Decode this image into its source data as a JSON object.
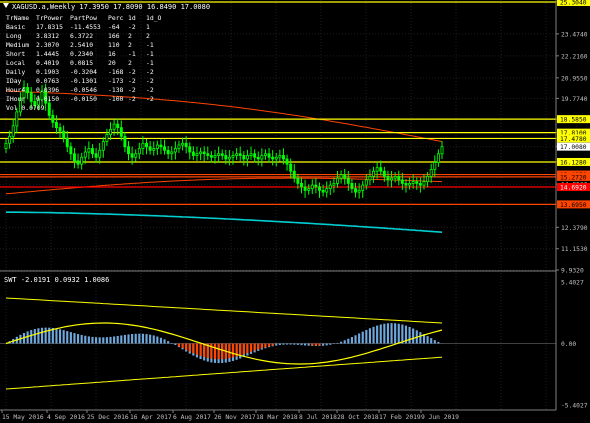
{
  "header": {
    "title": "XAGUSD.a,Weekly  17.3950 17.8090 16.8490 17.0080"
  },
  "info_table": {
    "header": [
      "TrName",
      "TrPower",
      "PartPow",
      "Perc",
      "1d",
      "1d_O"
    ],
    "rows": [
      [
        "Basic",
        "17.8315",
        "-11.4553",
        "-64",
        "-2",
        "1"
      ],
      [
        "Long",
        "3.8312",
        "6.3722",
        "166",
        "2",
        "2"
      ],
      [
        "Medium",
        "2.3070",
        "2.5410",
        "110",
        "2",
        "-1"
      ],
      [
        "Short",
        "1.4445",
        "0.2340",
        "16",
        "-1",
        "-1"
      ],
      [
        "Local",
        "0.4019",
        "0.0815",
        "20",
        "2",
        "-1"
      ],
      [
        "Daily",
        "0.1903",
        "-0.3204",
        "-168",
        "-2",
        "-2"
      ],
      [
        "IDay",
        "0.0763",
        "-0.1301",
        "-173",
        "-2",
        "-2"
      ],
      [
        "Hour4",
        "0.0396",
        "-0.0546",
        "-138",
        "-2",
        "-2"
      ],
      [
        "IHour",
        "0.0150",
        "-0.0150",
        "-100",
        "-2",
        "-2"
      ]
    ],
    "extra": "Vol 0.0709"
  },
  "sub_header": "SWT -2.0191 0.0932 1.0086",
  "price_axis": [
    "25.3040",
    "23.4740",
    "22.2160",
    "20.9550",
    "19.7740",
    "18.5850",
    "17.8100",
    "17.4780",
    "17.0080",
    "16.1280",
    "14.8530",
    "12.3790",
    "11.1530",
    "9.9320"
  ],
  "level_labels": [
    {
      "text": "25.3040",
      "bg": "#ffff00",
      "fg": "#000000"
    },
    {
      "text": "18.5850",
      "bg": "#ffff00",
      "fg": "#000000"
    },
    {
      "text": "17.8100",
      "bg": "#ffff00",
      "fg": "#000000"
    },
    {
      "text": "17.4780",
      "bg": "#ffff00",
      "fg": "#000000"
    },
    {
      "text": "17.0080",
      "bg": "#ffffff",
      "fg": "#000000"
    },
    {
      "text": "16.1280",
      "bg": "#ffff00",
      "fg": "#000000"
    },
    {
      "text": "15.4070",
      "bg": "#ff4500",
      "fg": "#000000"
    },
    {
      "text": "15.2720",
      "bg": "#ff4500",
      "fg": "#000000"
    },
    {
      "text": "14.6920",
      "bg": "#ff0000",
      "fg": "#ffffff"
    },
    {
      "text": "13.6950",
      "bg": "#ff4500",
      "fg": "#000000"
    }
  ],
  "osc_axis": [
    "5.4027",
    "0.00",
    "-5.4027"
  ],
  "time_axis": [
    "15 May 2016",
    "4 Sep 2016",
    "25 Dec 2016",
    "16 Apr 2017",
    "6 Aug 2017",
    "26 Nov 2017",
    "18 Mar 2018",
    "8 Jul 2018",
    "28 Oct 2018",
    "17 Feb 2019",
    "9 Jun 2019"
  ],
  "chart_data": {
    "type": "candlestick",
    "symbol": "XAGUSD.a",
    "timeframe": "Weekly",
    "last": {
      "open": 17.395,
      "high": 17.809,
      "low": 16.849,
      "close": 17.008
    },
    "price_range": [
      9.932,
      25.304
    ],
    "closes": [
      17.2,
      17.6,
      18.2,
      19.0,
      19.8,
      20.4,
      20.1,
      19.6,
      19.4,
      19.7,
      20.2,
      19.5,
      18.8,
      18.4,
      18.1,
      17.9,
      17.5,
      17.0,
      16.6,
      16.2,
      16.0,
      16.4,
      16.7,
      16.9,
      16.6,
      16.4,
      16.8,
      17.3,
      17.7,
      18.0,
      18.3,
      18.1,
      17.6,
      17.0,
      16.6,
      16.4,
      16.6,
      16.9,
      17.2,
      17.0,
      16.8,
      16.9,
      17.1,
      17.0,
      16.8,
      16.6,
      16.7,
      16.9,
      17.1,
      17.2,
      17.0,
      16.7,
      16.5,
      16.6,
      16.7,
      16.6,
      16.5,
      16.4,
      16.5,
      16.6,
      16.5,
      16.3,
      16.4,
      16.5,
      16.6,
      16.5,
      16.3,
      16.5,
      16.6,
      16.4,
      16.3,
      16.5,
      16.6,
      16.4,
      16.3,
      16.4,
      16.5,
      16.3,
      16.0,
      15.6,
      15.2,
      14.9,
      14.7,
      14.5,
      14.6,
      14.8,
      14.7,
      14.5,
      14.4,
      14.6,
      14.8,
      14.9,
      15.2,
      15.4,
      15.2,
      14.9,
      14.6,
      14.4,
      14.5,
      14.8,
      15.1,
      15.3,
      15.6,
      15.8,
      15.6,
      15.3,
      15.1,
      15.2,
      15.3,
      15.1,
      14.9,
      14.8,
      14.9,
      15.0,
      14.9,
      14.8,
      15.0,
      15.3,
      15.7,
      16.1,
      16.6,
      17.0
    ],
    "moving_averages": [
      {
        "color": "#ff4500",
        "start": 20.2,
        "end": 17.3
      },
      {
        "color": "#ff4500",
        "start": 14.3,
        "end": 15.0
      },
      {
        "color": "#00ced1",
        "start": 13.25,
        "end": 12.1
      }
    ],
    "horizontal_levels": [
      {
        "value": 25.304,
        "color": "#ffff00"
      },
      {
        "value": 18.585,
        "color": "#ffff00"
      },
      {
        "value": 17.81,
        "color": "#ffff00"
      },
      {
        "value": 17.478,
        "color": "#ffff00"
      },
      {
        "value": 16.128,
        "color": "#ffff00"
      },
      {
        "value": 15.407,
        "color": "#ff4500"
      },
      {
        "value": 15.272,
        "color": "#ff4500"
      },
      {
        "value": 14.692,
        "color": "#ff0000"
      },
      {
        "value": 13.695,
        "color": "#ff4500"
      }
    ],
    "oscillator": {
      "name": "SWT",
      "values": [
        -2.0191,
        0.0932,
        1.0086
      ],
      "range": [
        -5.4027,
        5.4027
      ]
    }
  },
  "colors": {
    "background": "#000000",
    "grid": "#1e1e1e",
    "candle": "#00ff00",
    "axis_text": "#c0c0c0",
    "level": "#ffff00",
    "resistance": "#ff4500",
    "support_ma": "#00ced1"
  }
}
